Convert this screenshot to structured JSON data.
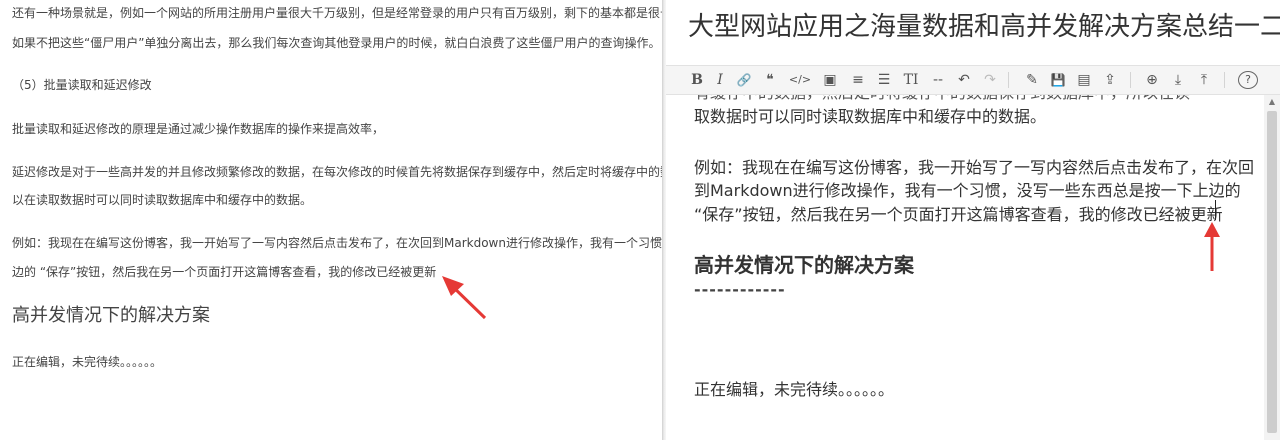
{
  "preview": {
    "lines": [
      "还有一种场景就是，例如一个网站的所用注册用户量很大千万级别，但是经常登录的用户只有百万级别，剩下的基本都是很长时间不会登录的",
      "如果不把这些“僵尸用户”单独分离出去，那么我们每次查询其他登录用户的时候，就白白浪费了这些僵尸用户的查询操作。",
      "（5）批量读取和延迟修改",
      "批量读取和延迟修改的原理是通过减少操作数据库的操作来提高效率，",
      "延迟修改是对于一些高并发的并且修改频繁修改的数据，在每次修改的时候首先将数据保存到缓存中，然后定时将缓存中的数据保存到数据库中",
      "以在读取数据时可以同时读取数据库中和缓存中的数据。",
      "例如：我现在在编写这份博客，我一开始写了一写内容然后点击发布了，在次回到Markdown进行修改操作，我有一个习惯，没写一些东西总是",
      "边的 “保存”按钮，然后我在另一个页面打开这篇博客查看，我的修改已经被更新",
      "高并发情况下的解决方案",
      "正在编辑，未完待续。。。。。。"
    ]
  },
  "editor": {
    "title": "大型网站应用之海量数据和高并发解决方案总结一二",
    "toolbar": {
      "bold": "B",
      "italic": "I",
      "link": "🔗",
      "quote": "❝",
      "code": "</>",
      "image": "▣",
      "ol": "≡",
      "ul": "☰",
      "heading": "TI",
      "hr": "--",
      "undo": "↶",
      "redo": "↷",
      "edit": "✎",
      "save": "💾",
      "preview": "▤",
      "export": "⇪",
      "globe": "⊕",
      "download": "⤓",
      "upload": "⤒",
      "help": "?"
    },
    "lines": [
      "有缓存中的数据，然后定时将缓存中的数据保存到数据库中，所以在读",
      "取数据时可以同时读取数据库中和缓存中的数据。",
      "例如：我现在在编写这份博客，我一开始写了一写内容然后点击发布了，在次回",
      "到Markdown进行修改操作，我有一个习惯，没写一些东西总是按一下上边的",
      " “保存”按钮，然后我在另一个页面打开这篇博客查看，我的修改已经被更新",
      "高并发情况下的解决方案",
      "------------",
      "正在编辑，未完待续。。。。。。"
    ]
  },
  "colors": {
    "annotation_arrow": "#e53935",
    "toolbar_bg": "#f5f5f5"
  }
}
